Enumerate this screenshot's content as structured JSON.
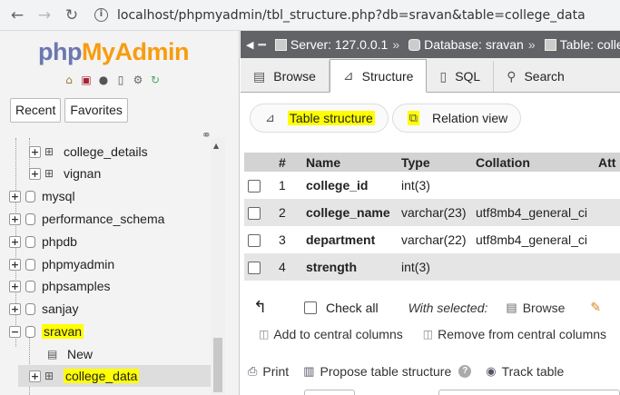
{
  "browser": {
    "url": "localhost/phpmyadmin/tbl_structure.php?db=sravan&table=college_data"
  },
  "sidebar": {
    "logo": {
      "php": "php",
      "my": "My",
      "admin": "Admin"
    },
    "tabs": [
      "Recent",
      "Favorites"
    ],
    "tree": [
      {
        "label": "college_details",
        "type": "table"
      },
      {
        "label": "vignan",
        "type": "table"
      },
      {
        "label": "mysql",
        "type": "db"
      },
      {
        "label": "performance_schema",
        "type": "db"
      },
      {
        "label": "phpdb",
        "type": "db"
      },
      {
        "label": "phpmyadmin",
        "type": "db"
      },
      {
        "label": "phpsamples",
        "type": "db"
      },
      {
        "label": "sanjay",
        "type": "db"
      },
      {
        "label": "sravan",
        "type": "db",
        "expanded": true,
        "highlighted": true
      },
      {
        "label": "New",
        "type": "new"
      },
      {
        "label": "college_data",
        "type": "table",
        "highlighted": true,
        "selected": true
      }
    ]
  },
  "breadcrumb": {
    "server": "Server: 127.0.0.1",
    "database": "Database: sravan",
    "table": "Table: colle"
  },
  "tabs": [
    "Browse",
    "Structure",
    "SQL",
    "Search"
  ],
  "active_tab": "Structure",
  "subtabs": [
    "Table structure",
    "Relation view"
  ],
  "table": {
    "headers": [
      "#",
      "Name",
      "Type",
      "Collation",
      "Att"
    ],
    "rows": [
      {
        "num": "1",
        "name": "college_id",
        "type": "int(3)",
        "collation": ""
      },
      {
        "num": "2",
        "name": "college_name",
        "type": "varchar(23)",
        "collation": "utf8mb4_general_ci"
      },
      {
        "num": "3",
        "name": "department",
        "type": "varchar(22)",
        "collation": "utf8mb4_general_ci"
      },
      {
        "num": "4",
        "name": "strength",
        "type": "int(3)",
        "collation": ""
      }
    ]
  },
  "actions": {
    "check_all": "Check all",
    "with_selected": "With selected:",
    "browse": "Browse",
    "add_central": "Add to central columns",
    "remove_central": "Remove from central columns",
    "print": "Print",
    "propose": "Propose table structure",
    "track": "Track table"
  },
  "colors": {
    "highlight": "#ffff00",
    "serverbar": "#626366",
    "logo_php": "#6c78af",
    "logo_myadmin": "#f89c0e"
  }
}
